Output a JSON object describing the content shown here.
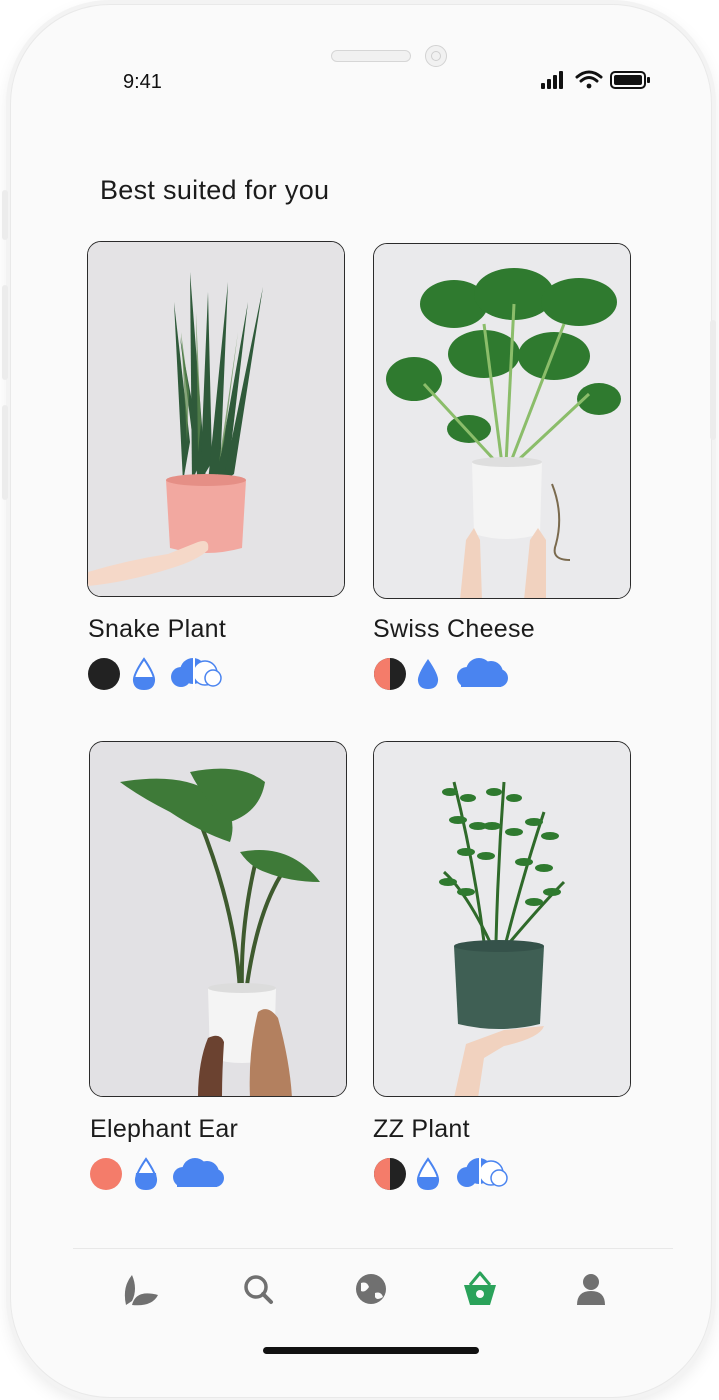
{
  "status_bar": {
    "time": "9:41",
    "icons": [
      "cellular-signal-icon",
      "wifi-icon",
      "battery-icon"
    ]
  },
  "section": {
    "title": "Best suited for you"
  },
  "plants": [
    {
      "name": "Snake Plant",
      "light": "low",
      "water": "half",
      "humidity": "medium"
    },
    {
      "name": "Swiss Cheese",
      "light": "medium",
      "water": "low",
      "humidity": "high"
    },
    {
      "name": "Elephant Ear",
      "light": "bright",
      "water": "half",
      "humidity": "high"
    },
    {
      "name": "ZZ Plant",
      "light": "medium",
      "water": "low",
      "humidity": "medium"
    }
  ],
  "tab_bar": {
    "items": [
      "plants-tab",
      "search-tab",
      "explore-tab",
      "shop-tab",
      "profile-tab"
    ],
    "active": "shop-tab"
  },
  "colors": {
    "accent_blue": "#4a84f0",
    "light_coral": "#f47c6a",
    "dark": "#222222",
    "active_tab": "#2aa25a",
    "inactive_tab": "#707070"
  }
}
